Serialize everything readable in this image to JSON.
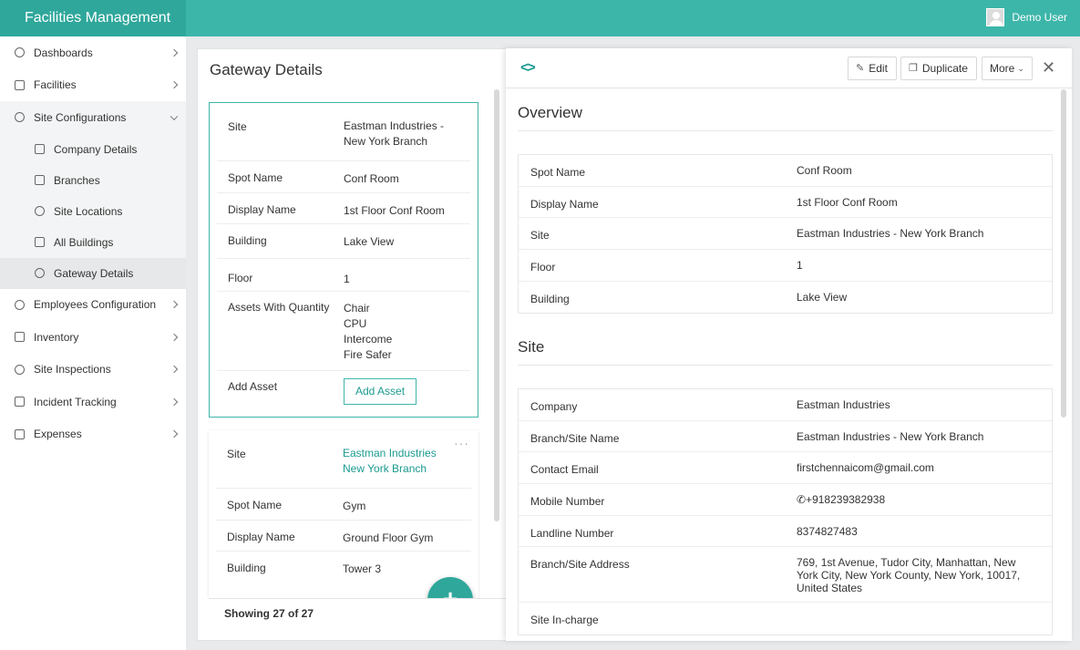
{
  "app": {
    "title": "Facilities Management",
    "user_name": "Demo User"
  },
  "sidebar": {
    "items": [
      {
        "label": "Dashboards"
      },
      {
        "label": "Facilities"
      },
      {
        "label": "Site Configurations"
      },
      {
        "label": "Employees Configuration"
      },
      {
        "label": "Inventory"
      },
      {
        "label": "Site Inspections"
      },
      {
        "label": "Incident Tracking"
      },
      {
        "label": "Expenses"
      }
    ],
    "sub_items": [
      {
        "label": "Company Details"
      },
      {
        "label": "Branches"
      },
      {
        "label": "Site Locations"
      },
      {
        "label": "All Buildings"
      },
      {
        "label": "Gateway Details"
      }
    ]
  },
  "list": {
    "title": "Gateway Details",
    "footer": "Showing 27 of 27",
    "fab_label": "+",
    "card1": {
      "site_label": "Site",
      "site_value": "Eastman Industries - New York Branch",
      "spot_label": "Spot Name",
      "spot_value": "Conf Room",
      "display_label": "Display Name",
      "display_value": "1st Floor Conf Room",
      "building_label": "Building",
      "building_value": "Lake View",
      "floor_label": "Floor",
      "floor_value": "1",
      "assets_label": "Assets With Quantity",
      "assets": [
        "Chair",
        "CPU",
        "Intercome",
        "Fire Safer"
      ],
      "add_label": "Add Asset",
      "add_button": "Add Asset"
    },
    "card2": {
      "more": "···",
      "site_label": "Site",
      "site_value_1": "Eastman Industries",
      "site_value_2": "New York Branch",
      "spot_label": "Spot Name",
      "spot_value": "Gym",
      "display_label": "Display Name",
      "display_value": "Ground Floor Gym",
      "building_label": "Building",
      "building_value": "Tower 3"
    }
  },
  "detail": {
    "toolbar": {
      "code": "<>",
      "edit": "Edit",
      "duplicate": "Duplicate",
      "more": "More",
      "close": "✕"
    },
    "overview": {
      "title": "Overview",
      "rows": [
        {
          "label": "Spot Name",
          "value": "Conf Room"
        },
        {
          "label": "Display Name",
          "value": "1st Floor Conf Room"
        },
        {
          "label": "Site",
          "value": "Eastman Industries - New York Branch"
        },
        {
          "label": "Floor",
          "value": "1"
        },
        {
          "label": "Building",
          "value": "Lake View"
        }
      ]
    },
    "site": {
      "title": "Site",
      "rows": [
        {
          "label": "Company",
          "value": "Eastman Industries"
        },
        {
          "label": "Branch/Site Name",
          "value": "Eastman Industries - New York Branch"
        },
        {
          "label": "Contact Email",
          "value": "firstchennaicom@gmail.com"
        },
        {
          "label": "Mobile Number",
          "value": "+918239382938"
        },
        {
          "label": "Landline Number",
          "value": "8374827483"
        },
        {
          "label": "Branch/Site Address",
          "value": "769, 1st Avenue, Tudor City, Manhattan, New York City, New York County, New York, 10017, United States"
        },
        {
          "label": "Site In-charge",
          "value": ""
        }
      ]
    }
  }
}
